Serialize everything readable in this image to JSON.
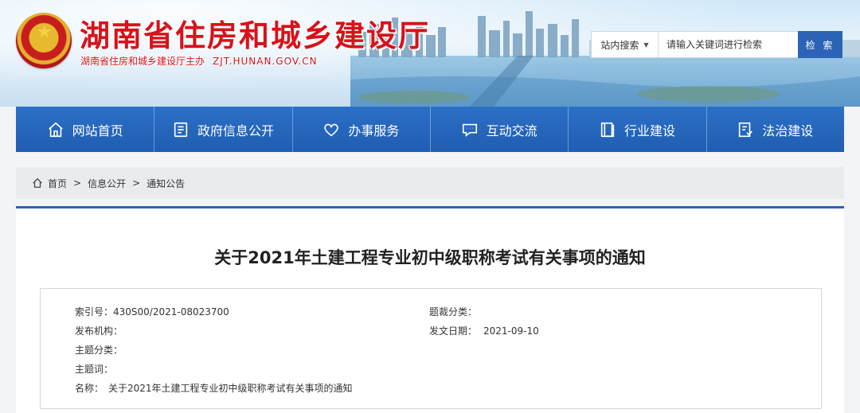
{
  "header": {
    "site_title": "湖南省住房和城乡建设厅",
    "site_subtitle": "湖南省住房和城乡建设厅主办",
    "site_domain": "ZJT.HUNAN.GOV.CN"
  },
  "search": {
    "scope_label": "站内搜索",
    "placeholder": "请输入关键词进行检索",
    "button_label": "检 索"
  },
  "nav": {
    "items": [
      {
        "label": "网站首页",
        "icon": "home-icon"
      },
      {
        "label": "政府信息公开",
        "icon": "document-icon"
      },
      {
        "label": "办事服务",
        "icon": "heart-icon"
      },
      {
        "label": "互动交流",
        "icon": "chat-icon"
      },
      {
        "label": "行业建设",
        "icon": "book-icon"
      },
      {
        "label": "法治建设",
        "icon": "law-icon"
      }
    ]
  },
  "breadcrumb": {
    "items": [
      "首页",
      "信息公开",
      "通知公告"
    ],
    "separator": ">"
  },
  "article": {
    "title": "关于2021年土建工程专业初中级职称考试有关事项的通知",
    "meta": {
      "index_label": "索引号：",
      "index_value": "430S00/2021-08023700",
      "theme_cat_label": "题裁分类：",
      "theme_cat_value": "",
      "publisher_label": "发布机构：",
      "publisher_value": "",
      "date_label": "发文日期：",
      "date_value": "2021-09-10",
      "topic_label": "主题分类：",
      "topic_value": "",
      "keywords_label": "主题词：",
      "keywords_value": "",
      "name_label": "名称：",
      "name_value": "关于2021年土建工程专业初中级职称考试有关事项的通知"
    }
  },
  "colors": {
    "brand_red": "#d8121a",
    "nav_blue": "#2b63b6",
    "accent_blue": "#2b63b6"
  }
}
